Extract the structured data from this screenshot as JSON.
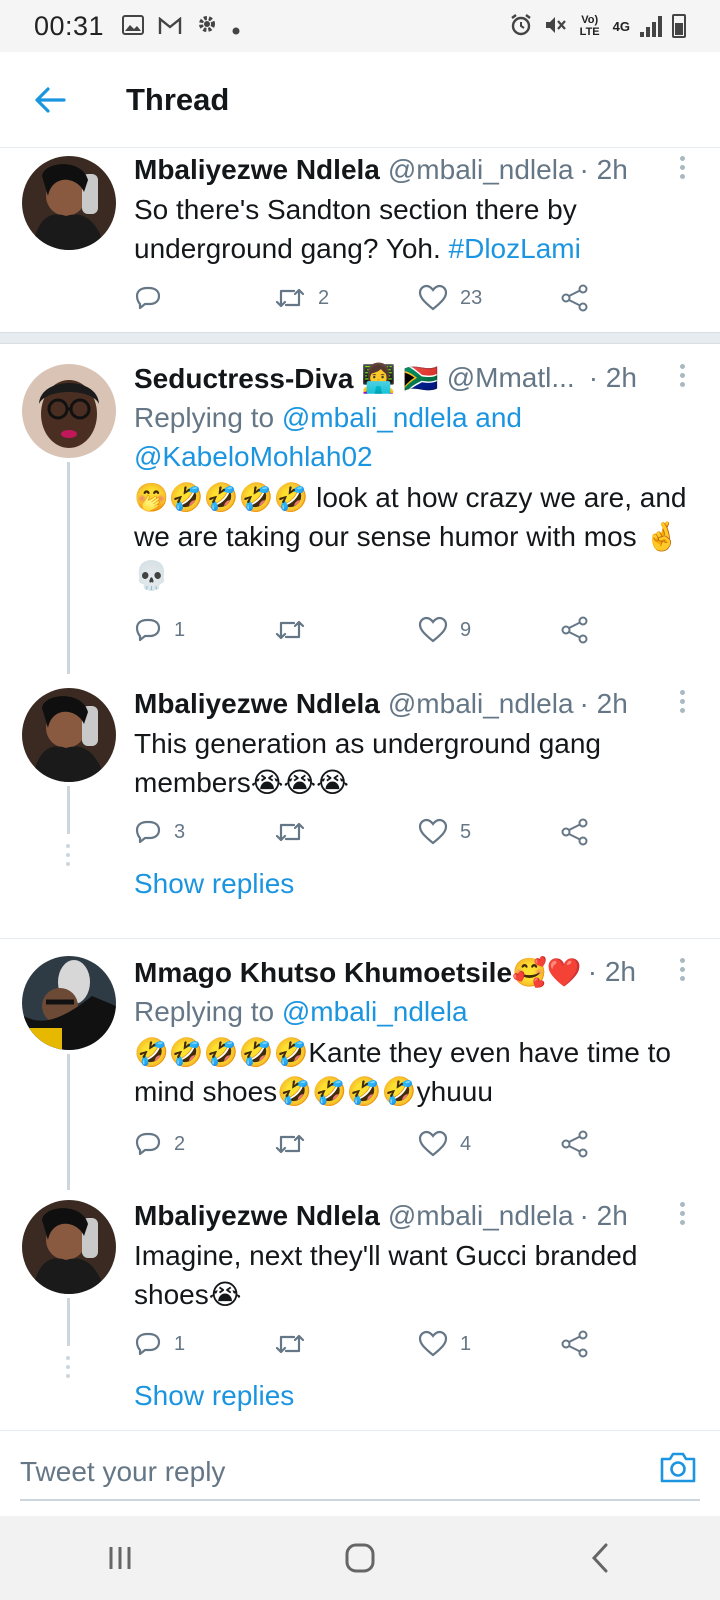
{
  "status_bar": {
    "time": "00:31",
    "left_icons": [
      "image-icon",
      "gmail-icon",
      "settings-icon",
      "dot-icon"
    ],
    "right_icons": [
      "alarm-icon",
      "mute-icon",
      "volte-icon",
      "4g-icon",
      "signal-icon",
      "battery-icon"
    ],
    "volte_label": "Vo) LTE",
    "network_label": "4G"
  },
  "header": {
    "title": "Thread"
  },
  "tweets": [
    {
      "name": "Mbaliyezwe Ndlela",
      "handle": "@mbali_ndlela",
      "time": "· 2h",
      "text": "So there's Sandton section there by underground gang? Yoh. ",
      "hashtag": "#DlozLami",
      "replies": "",
      "retweets": "2",
      "likes": "23"
    },
    {
      "name": "Seductress-Diva 👩‍💻 🇿🇦",
      "handle": "@Mmatl...",
      "time": "· 2h",
      "replying_prefix": "Replying to",
      "replying_to": "@mbali_ndlela and @KabeloMohlah02",
      "text": "🤭🤣🤣🤣🤣 look at how crazy we are, and we are taking our sense humor with mos 🤞💀",
      "replies": "1",
      "retweets": "",
      "likes": "9"
    },
    {
      "name": "Mbaliyezwe Ndlela",
      "handle": "@mbali_ndlela",
      "time": "· 2h",
      "text": "This generation as underground gang members😭😭😭",
      "replies": "3",
      "retweets": "",
      "likes": "5",
      "show_replies": "Show replies"
    },
    {
      "name": "Mmago Khutso Khumoetsile🥰❤️",
      "handle": "",
      "time": "· 2h",
      "replying_prefix": "Replying to",
      "replying_to": "@mbali_ndlela",
      "text": "🤣🤣🤣🤣🤣Kante they even have time to mind shoes🤣🤣🤣🤣yhuuu",
      "replies": "2",
      "retweets": "",
      "likes": "4"
    },
    {
      "name": "Mbaliyezwe Ndlela",
      "handle": "@mbali_ndlela",
      "time": "· 2h",
      "text": "Imagine, next they'll want Gucci branded shoes😭",
      "replies": "1",
      "retweets": "",
      "likes": "1",
      "show_replies": "Show replies"
    }
  ],
  "reply_bar": {
    "placeholder": "Tweet your reply"
  },
  "colors": {
    "accent": "#1b95e0",
    "secondary_text": "#657786",
    "divider": "#e6ecf0"
  }
}
